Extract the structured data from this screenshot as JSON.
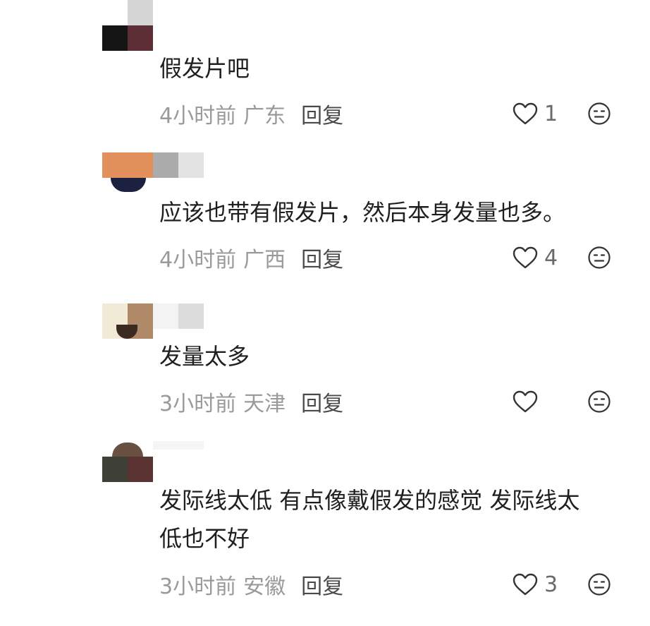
{
  "comments": [
    {
      "text": "假发片吧",
      "time": "4小时前",
      "location": "广东",
      "reply_label": "回复",
      "likes": "1"
    },
    {
      "text": "应该也带有假发片，然后本身发量也多。",
      "time": "4小时前",
      "location": "广西",
      "reply_label": "回复",
      "likes": "4"
    },
    {
      "text": "发量太多",
      "time": "3小时前",
      "location": "天津",
      "reply_label": "回复",
      "likes": ""
    },
    {
      "text": "发际线太低 有点像戴假发的感觉 发际线太\n低也不好",
      "time": "3小时前",
      "location": "安徽",
      "reply_label": "回复",
      "likes": "3"
    }
  ],
  "icons": {
    "like": "heart-outline-icon",
    "dislike": "unhappy-face-icon"
  },
  "colors": {
    "meta_text": "#9a9a9a",
    "reply_text": "#4a4a4a",
    "icon_stroke": "#333333",
    "body_text": "#1f1f1f"
  }
}
